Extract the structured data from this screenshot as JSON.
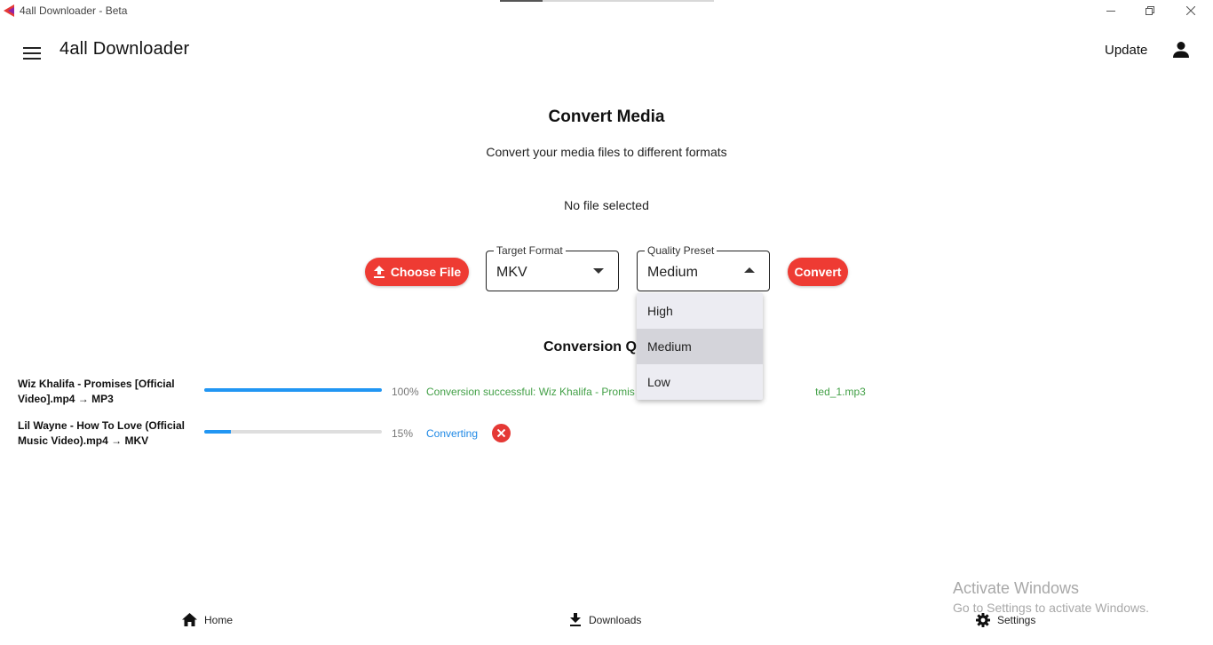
{
  "window": {
    "title": "4all Downloader - Beta"
  },
  "appbar": {
    "title": "4all Downloader",
    "update_label": "Update"
  },
  "main": {
    "title": "Convert Media",
    "subtitle": "Convert your media files to different formats",
    "file_status": "No file selected",
    "choose_file_label": "Choose File",
    "convert_label": "Convert",
    "target_format": {
      "label": "Target Format",
      "value": "MKV"
    },
    "quality_preset": {
      "label": "Quality Preset",
      "value": "Medium",
      "options": [
        "High",
        "Medium",
        "Low"
      ],
      "selected_index": 1
    }
  },
  "queue": {
    "title": "Conversion Q",
    "items": [
      {
        "name": "Wiz Khalifa - Promises [Official Video].mp4 → MP3",
        "progress_percent": 100,
        "percent_text": "100%",
        "status": "Conversion successful: Wiz Khalifa - Promis",
        "status_tail": "ted_1.mp3",
        "status_color": "#43a047"
      },
      {
        "name": "Lil Wayne - How To Love (Official Music Video).mp4 → MKV",
        "progress_percent": 15,
        "percent_text": "15%",
        "status": "Converting",
        "status_color": "#1e88e5"
      }
    ]
  },
  "bottom_nav": {
    "home": "Home",
    "downloads": "Downloads",
    "settings": "Settings"
  },
  "watermark": {
    "line1": "Activate Windows",
    "line2": "Go to Settings to activate Windows."
  },
  "colors": {
    "accent": "#ee3b33",
    "progress": "#2196f3",
    "success": "#43a047",
    "info": "#1e88e5"
  }
}
